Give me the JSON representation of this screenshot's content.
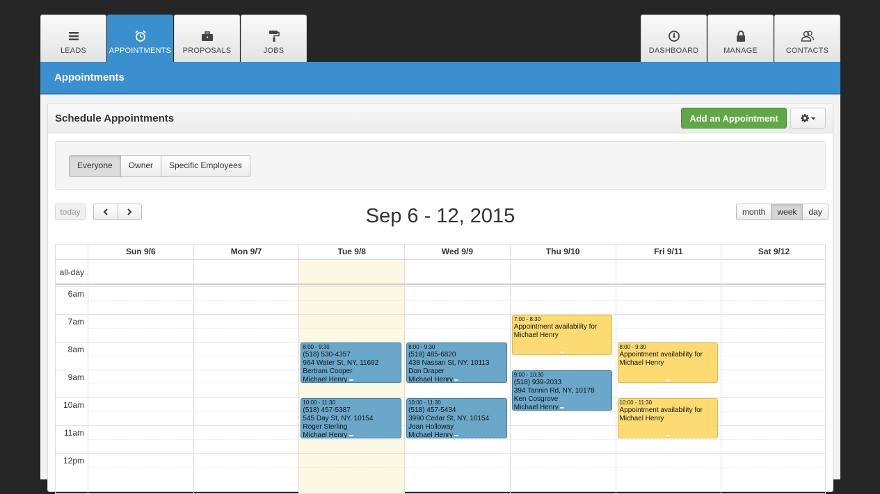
{
  "nav": {
    "left_tabs": [
      {
        "label": "LEADS",
        "icon": "list-icon"
      },
      {
        "label": "APPOINTMENTS",
        "icon": "alarm-clock-icon",
        "active": true
      },
      {
        "label": "PROPOSALS",
        "icon": "briefcase-icon"
      },
      {
        "label": "JOBS",
        "icon": "paint-roller-icon"
      }
    ],
    "right_tabs": [
      {
        "label": "DASHBOARD",
        "icon": "gauge-icon"
      },
      {
        "label": "MANAGE",
        "icon": "lock-icon"
      },
      {
        "label": "CONTACTS",
        "icon": "users-icon"
      }
    ]
  },
  "banner": {
    "title": "Appointments"
  },
  "panel": {
    "title": "Schedule Appointments",
    "add_label": "Add an Appointment",
    "settings_icon": "gear-icon"
  },
  "filters": {
    "options": [
      "Everyone",
      "Owner",
      "Specific Employees"
    ],
    "selected": "Everyone"
  },
  "toolbar": {
    "today_label": "today",
    "prev_label": "‹",
    "next_label": "›",
    "range_title": "Sep 6 - 12, 2015",
    "views": [
      "month",
      "week",
      "day"
    ],
    "selected_view": "week"
  },
  "calendar": {
    "allday_label": "all-day",
    "days": [
      "Sun 9/6",
      "Mon 9/7",
      "Tue 9/8",
      "Wed 9/9",
      "Thu 9/10",
      "Fri 9/11",
      "Sat 9/12"
    ],
    "today_index": 2,
    "hours": [
      "6am",
      "7am",
      "8am",
      "9am",
      "10am",
      "11am",
      "12pm"
    ],
    "events": [
      {
        "day": 2,
        "start": 8,
        "end": 9.5,
        "time": "8:00 - 9:30",
        "lines": [
          "(518) 530-4357",
          "964 Water St, NY, 11692",
          "Bertram Cooper",
          "Michael Henry"
        ],
        "color": "blue"
      },
      {
        "day": 2,
        "start": 10,
        "end": 11.5,
        "time": "10:00 - 11:30",
        "lines": [
          "(518) 457-5387",
          "545 Day St, NY, 10154",
          "Roger Sterling",
          "Michael Henry"
        ],
        "color": "blue"
      },
      {
        "day": 3,
        "start": 8,
        "end": 9.5,
        "time": "8:00 - 9:30",
        "lines": [
          "(518) 485-6820",
          "438 Nassan St, NY, 10113",
          "Don Draper",
          "Michael Henry"
        ],
        "color": "blue"
      },
      {
        "day": 3,
        "start": 10,
        "end": 11.5,
        "time": "10:00 - 11:30",
        "lines": [
          "(518) 457-5434",
          "3990 Cedar St, NY, 10154",
          "Joan Holloway",
          "Michael Henry"
        ],
        "color": "blue"
      },
      {
        "day": 4,
        "start": 7,
        "end": 8.5,
        "time": "7:00 - 8:30",
        "lines": [
          "Appointment availability for Michael Henry"
        ],
        "color": "yellow"
      },
      {
        "day": 4,
        "start": 9,
        "end": 10.5,
        "time": "9:00 - 10:30",
        "lines": [
          "(518) 939-2033",
          "394 Tannin Rd, NY, 10178",
          "Ken Cosgrove",
          "Michael Henry"
        ],
        "color": "blue"
      },
      {
        "day": 5,
        "start": 8,
        "end": 9.5,
        "time": "8:00 - 9:30",
        "lines": [
          "Appointment availability for Michael Henry"
        ],
        "color": "yellow"
      },
      {
        "day": 5,
        "start": 10,
        "end": 11.5,
        "time": "10:00 - 11:30",
        "lines": [
          "Appointment availability for Michael Henry"
        ],
        "color": "yellow"
      }
    ]
  },
  "colors": {
    "brand_blue": "#3a8fce",
    "add_green": "#5fa845",
    "event_blue": "#6aa7c9",
    "event_yellow": "#fddb73",
    "today_bg": "#fcf8e3"
  }
}
